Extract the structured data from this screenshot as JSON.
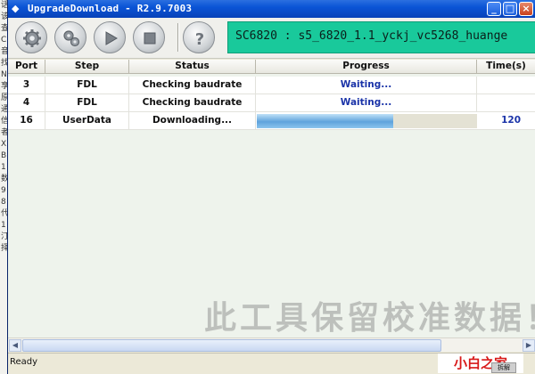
{
  "window": {
    "title": "UpgradeDownload - R2.9.7003",
    "device_text": "SC6820 : s5_6820_1.1_yckj_vc5268_huange",
    "controls": {
      "minimize": "_",
      "maximize": "□",
      "close": "×"
    }
  },
  "toolbar": {
    "buttons": [
      {
        "name": "settings-button",
        "icon": "gear-icon"
      },
      {
        "name": "options-button",
        "icon": "gears-icon"
      },
      {
        "name": "start-button",
        "icon": "play-icon"
      },
      {
        "name": "stop-button",
        "icon": "stop-icon"
      },
      {
        "name": "help-button",
        "icon": "question-icon"
      }
    ]
  },
  "table": {
    "headers": [
      "Port",
      "Step",
      "Status",
      "Progress",
      "Time(s)"
    ],
    "rows": [
      {
        "port": "3",
        "step": "FDL",
        "status": "Checking baudrate",
        "progress": "Waiting...",
        "time": ""
      },
      {
        "port": "4",
        "step": "FDL",
        "status": "Checking baudrate",
        "progress": "Waiting...",
        "time": ""
      },
      {
        "port": "16",
        "step": "UserData",
        "status": "Downloading...",
        "progress_fraction": 0.62,
        "time": "120"
      }
    ]
  },
  "left_strip_chars": [
    "话",
    "该",
    "查",
    "C",
    "音",
    "找",
    "N",
    "享",
    "原",
    "通",
    "信",
    "者",
    "X",
    "B",
    "1",
    "数",
    "9",
    "8",
    "代",
    "1",
    "汀",
    "择"
  ],
  "watermark": "此工具保留校准数据！",
  "status": {
    "text": "Ready",
    "brand": "小白之家",
    "stamp": "拆解"
  },
  "colors": {
    "title_bar": "#0a54d6",
    "device_bar": "#19c99b",
    "waiting_text": "#1a33a8",
    "brand_text": "#d81818"
  }
}
